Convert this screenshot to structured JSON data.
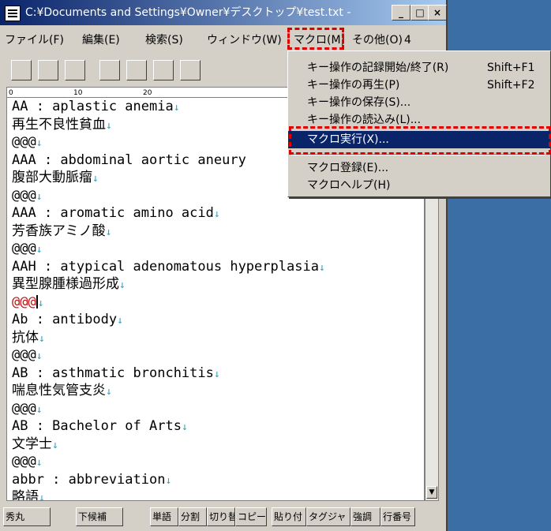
{
  "window": {
    "title": "C:¥Documents and Settings¥Owner¥デスクトップ¥test.txt",
    "title_suffix": "-"
  },
  "menubar": {
    "items": [
      "ファイル(F)",
      "編集(E)",
      "検索(S)",
      "ウィンドウ(W)",
      "マクロ(M)",
      "その他(O)"
    ],
    "count": "4"
  },
  "ruler": {
    "ticks": [
      "0",
      "10",
      "20"
    ]
  },
  "editor": {
    "lines": [
      {
        "text": "AA : aplastic anemia",
        "eol": "↓"
      },
      {
        "text": "再生不良性貧血",
        "eol": "↓"
      },
      {
        "text": "@@@",
        "eol": "↓"
      },
      {
        "text": "AAA : abdominal aortic aneury",
        "eol": ""
      },
      {
        "text": "腹部大動脈瘤",
        "eol": "↓"
      },
      {
        "text": "@@@",
        "eol": "↓"
      },
      {
        "text": "AAA : aromatic amino acid",
        "eol": "↓"
      },
      {
        "text": "芳香族アミノ酸",
        "eol": "↓"
      },
      {
        "text": "@@@",
        "eol": "↓"
      },
      {
        "text": "AAH : atypical adenomatous hyperplasia",
        "eol": "↓"
      },
      {
        "text": "異型腺腫様過形成",
        "eol": "↓"
      },
      {
        "text": "@@@",
        "eol": "↓"
      },
      {
        "text": "Ab : antibody",
        "eol": "↓"
      },
      {
        "text": "抗体",
        "eol": "↓"
      },
      {
        "text": "@@@",
        "eol": "↓"
      },
      {
        "text": "AB : asthmatic bronchitis",
        "eol": "↓"
      },
      {
        "text": "喘息性気管支炎",
        "eol": "↓"
      },
      {
        "text": "@@@",
        "eol": "↓"
      },
      {
        "text": "AB : Bachelor of Arts",
        "eol": "↓"
      },
      {
        "text": "文学士",
        "eol": "↓"
      },
      {
        "text": "@@@",
        "eol": "↓"
      },
      {
        "text": "abbr : abbreviation",
        "eol": "↓"
      },
      {
        "text": "略語",
        "eol": "↓"
      },
      {
        "text": "@@@",
        "eol": "↓"
      }
    ]
  },
  "macro_menu": {
    "items": [
      {
        "label": "キー操作の記録開始/終了(R)",
        "shortcut": "Shift+F1"
      },
      {
        "label": "キー操作の再生(P)",
        "shortcut": "Shift+F2"
      },
      {
        "label": "キー操作の保存(S)...",
        "shortcut": ""
      },
      {
        "label": "キー操作の読込み(L)...",
        "shortcut": ""
      },
      {
        "label": "マクロ実行(X)...",
        "shortcut": ""
      },
      {
        "label": "マクロ登録(E)...",
        "shortcut": ""
      },
      {
        "label": "マクロヘルプ(H)",
        "shortcut": ""
      }
    ]
  },
  "function_keys": [
    "秀丸",
    "下候補",
    "単語",
    "分割",
    "切り替",
    "コピー",
    "貼り付",
    "タグジャ",
    "強調",
    "行番号"
  ],
  "colors": {
    "title_start": "#0a246a",
    "title_end": "#a6caf0",
    "highlight_dash": "#e00000",
    "eol_mark": "#2aa0c0",
    "selected_bg": "#0a246a"
  }
}
